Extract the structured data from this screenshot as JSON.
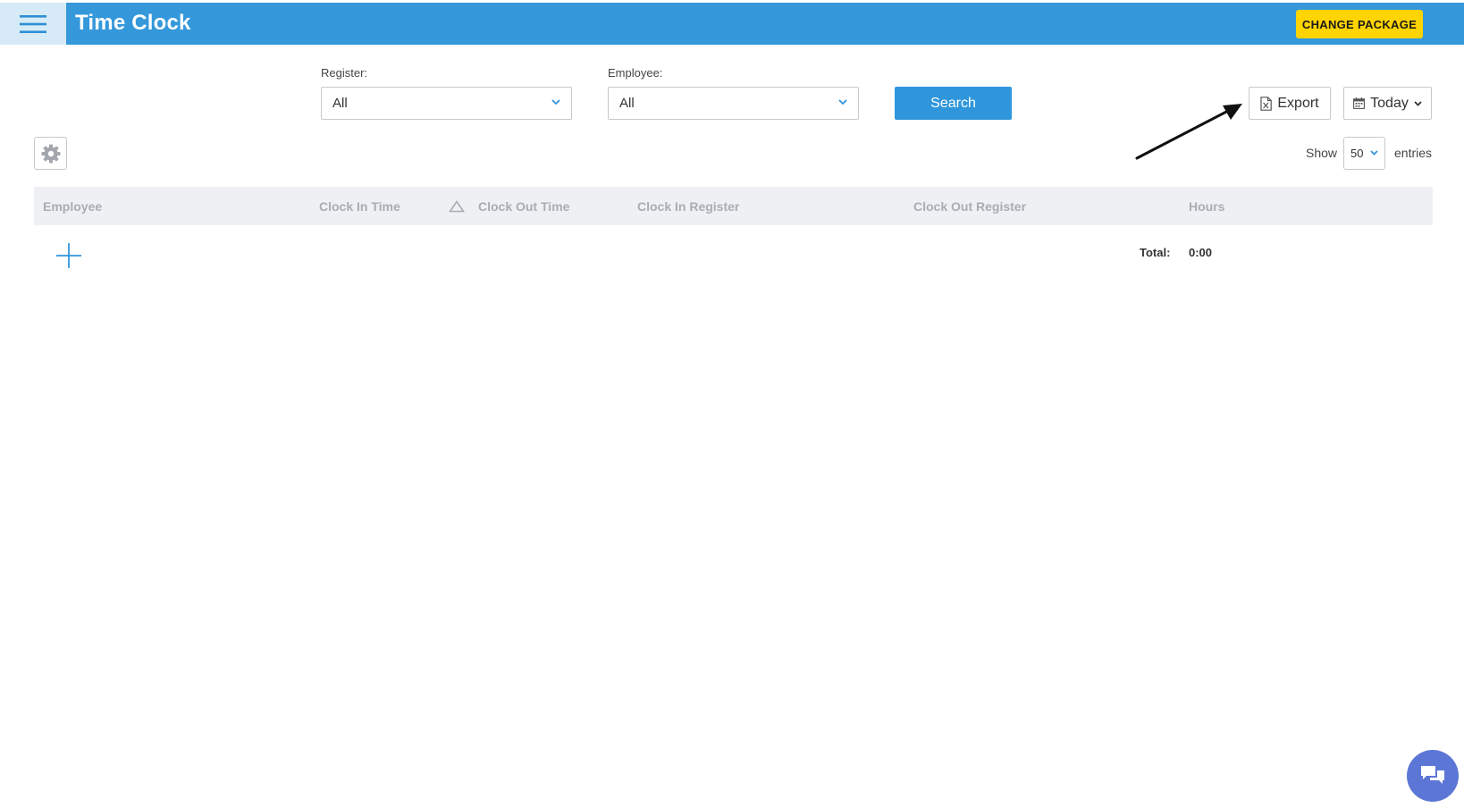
{
  "header": {
    "title": "Time Clock",
    "change_package_label": "CHANGE PACKAGE",
    "menu_icon": "hamburger-icon"
  },
  "filters": {
    "register_label": "Register:",
    "register_value": "All",
    "employee_label": "Employee:",
    "employee_value": "All",
    "search_label": "Search",
    "export_label": "Export",
    "export_icon": "excel-file-icon",
    "date_range_label": "Today",
    "date_range_icon": "calendar-icon"
  },
  "table_controls": {
    "show_label": "Show",
    "entries_value": "50",
    "entries_label": "entries",
    "settings_icon": "gear-icon"
  },
  "table": {
    "columns": [
      "Employee",
      "Clock In Time",
      "Clock Out Time",
      "Clock In Register",
      "Clock Out Register",
      "Hours"
    ],
    "sort_icon": "sort-triangle-icon",
    "total_label": "Total:",
    "total_value": "0:00",
    "add_icon": "plus-icon"
  },
  "chat": {
    "icon": "chat-icon"
  },
  "colors": {
    "header_bg": "#3498db",
    "menu_bg": "#d6ebf7",
    "cta_yellow": "#ffd400",
    "primary_button": "#2f96db",
    "table_header_bg": "#eef0f3",
    "chat_bg": "#5c76d6"
  }
}
